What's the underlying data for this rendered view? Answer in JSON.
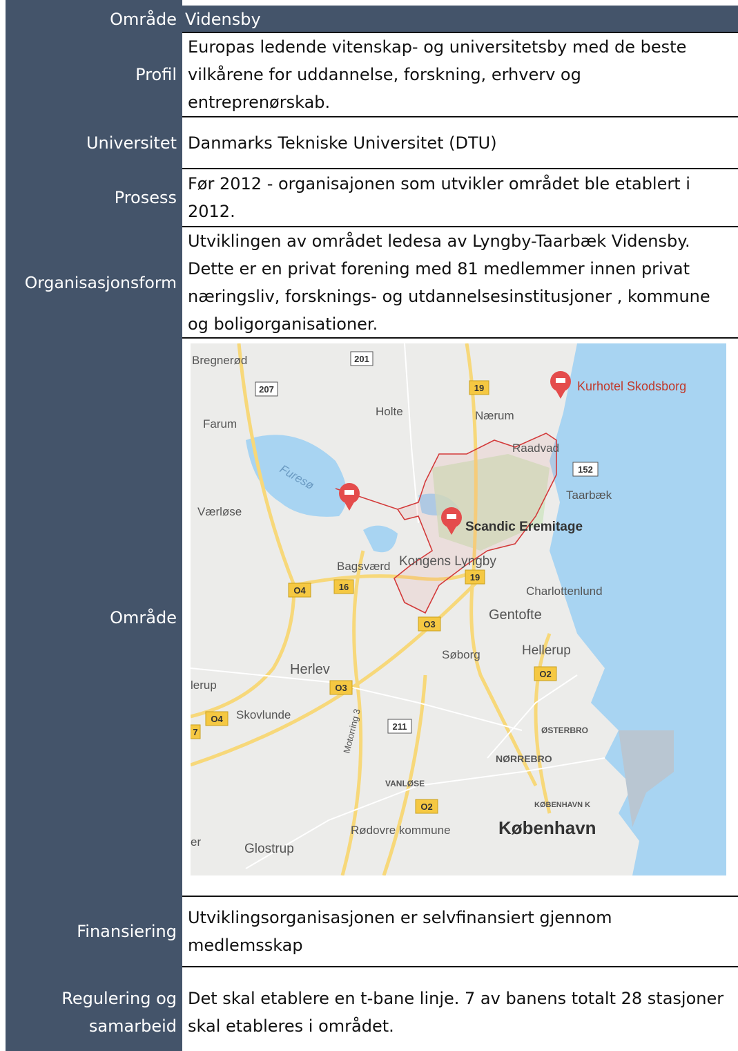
{
  "rows": {
    "omrade_header": {
      "label": "Område",
      "value": "Vidensby"
    },
    "profil": {
      "label": "Profil",
      "value": "Europas ledende vitenskap- og universitetsby med de beste vilkårene for uddannelse, forskning, erhverv og entreprenørskab."
    },
    "universitet": {
      "label": "Universitet",
      "value": "Danmarks Tekniske Universitet (DTU)"
    },
    "prosess": {
      "label": "Prosess",
      "value": "Før 2012 - organisajonen som utvikler området ble etablert i 2012."
    },
    "organisasjonsform": {
      "label": "Organisasjonsform",
      "value": "Utviklingen av området ledesa av Lyngby-Taarbæk Vidensby. Dette er en privat forening med  81  medlemmer innen privat næringsliv, forsknings- og utdannelsesinstitusjoner , kommune og boligorganisationer."
    },
    "omrade_map": {
      "label": "Område"
    },
    "finansiering": {
      "label": "Finansiering",
      "value": "Utviklingsorganisasjonen er selvfinansiert gjennom medlemsskap"
    },
    "regulering": {
      "label": "Regulering og samarbeid",
      "value": "Det skal etablere en  t-bane linje. 7 av banens totalt 28 stasjoner skal etableres i området."
    }
  },
  "map": {
    "places": {
      "bregnerod": "Bregnerød",
      "farum": "Farum",
      "holte": "Holte",
      "naerum": "Nærum",
      "kurhotel": "Kurhotel Skodsborg",
      "raadvad": "Raadvad",
      "taarbaek": "Taarbæk",
      "furesø": "Furesø",
      "vaerlose": "Værløse",
      "scandic": "Scandic Eremitage",
      "bagsvaerd": "Bagsværd",
      "kongens_lyngby": "Kongens Lyngby",
      "charlottenlund": "Charlottenlund",
      "gentofte": "Gentofte",
      "soborg": "Søborg",
      "hellerup": "Hellerup",
      "herlev": "Herlev",
      "lerup": "lerup",
      "skovlunde": "Skovlunde",
      "motorring": "Motorring 3",
      "osterbro": "ØSTERBRO",
      "norrebro": "NØRREBRO",
      "vanlose": "VANLØSE",
      "kobenhavn_k": "KØBENHAVN K",
      "kobenhavn": "København",
      "rodovre": "Rødovre kommune",
      "glostrup": "Glostrup",
      "er": "er"
    },
    "shields": {
      "r201": "201",
      "r207": "207",
      "r19a": "19",
      "r152": "152",
      "r04a": "O4",
      "r16": "16",
      "r19b": "19",
      "r03a": "O3",
      "r02a": "O2",
      "r03b": "O3",
      "r04b": "O4",
      "r211": "211",
      "r02b": "O2",
      "r7": "7"
    },
    "colors": {
      "water": "#a8d4f2",
      "land": "#ececea",
      "road": "#f7d87a",
      "boundary": "#d33a3a",
      "pin": "#e44c4c"
    }
  }
}
